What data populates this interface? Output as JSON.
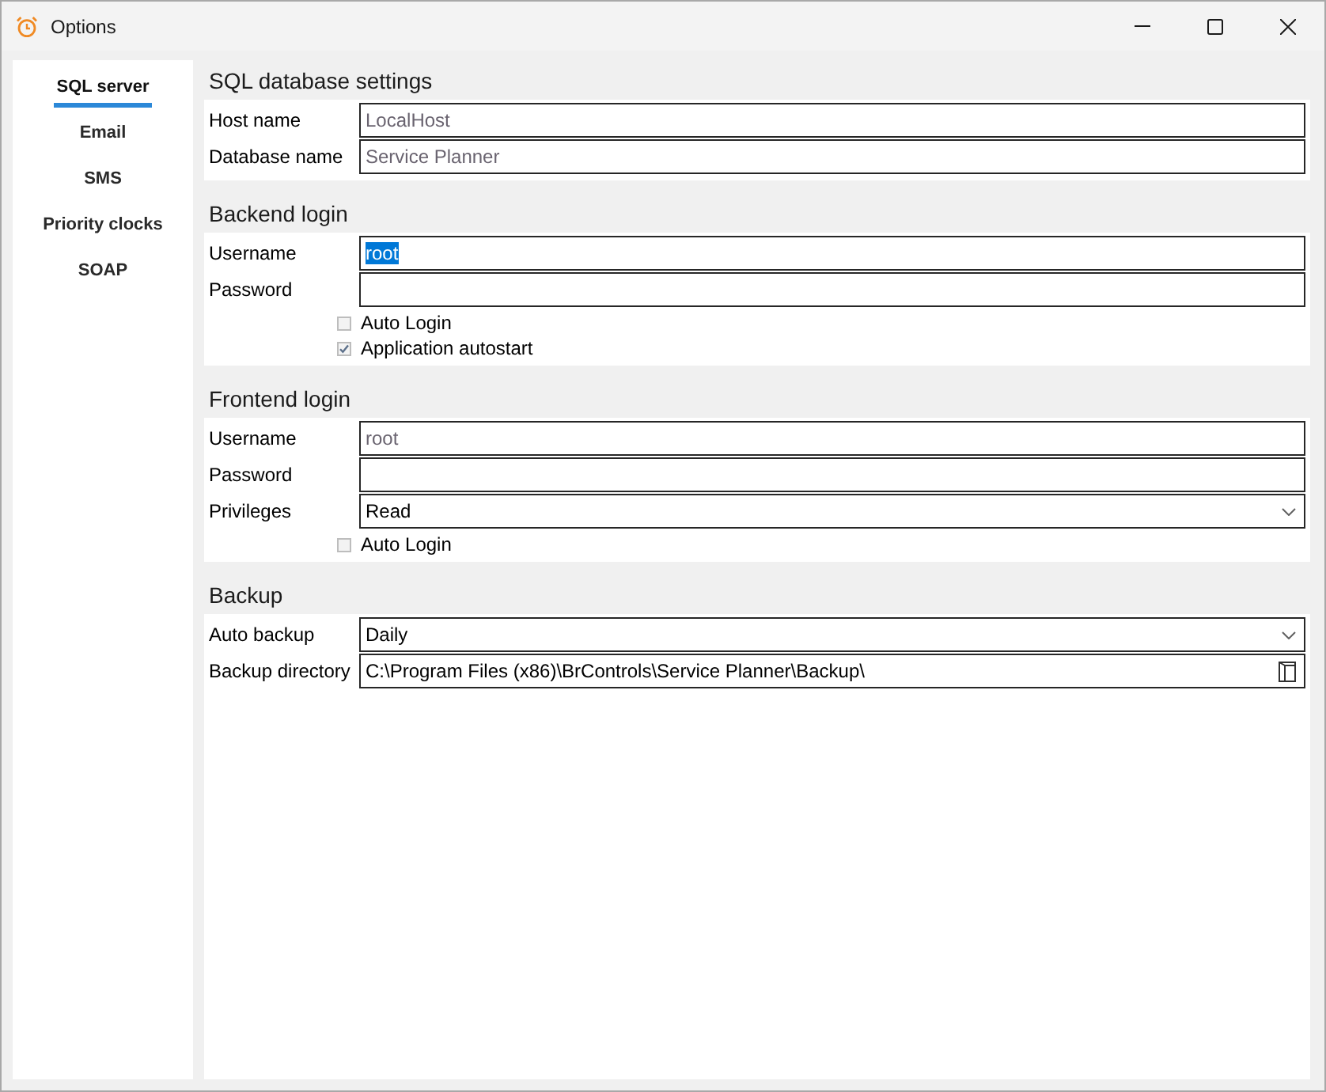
{
  "window": {
    "title": "Options"
  },
  "sidebar": {
    "items": [
      {
        "label": "SQL server",
        "selected": true
      },
      {
        "label": "Email",
        "selected": false
      },
      {
        "label": "SMS",
        "selected": false
      },
      {
        "label": "Priority clocks",
        "selected": false
      },
      {
        "label": "SOAP",
        "selected": false
      }
    ]
  },
  "sections": [
    {
      "title": "SQL database settings",
      "rows": [
        {
          "kind": "text",
          "label": "Host name",
          "placeholder": "LocalHost"
        },
        {
          "kind": "text",
          "label": "Database name",
          "placeholder": "Service Planner"
        }
      ]
    },
    {
      "title": "Backend login",
      "rows": [
        {
          "kind": "text",
          "label": "Username",
          "value": "root",
          "text_selected": true
        },
        {
          "kind": "text",
          "label": "Password"
        },
        {
          "kind": "checkbox",
          "label": "Auto Login",
          "checked": false
        },
        {
          "kind": "checkbox",
          "label": "Application autostart",
          "checked": true
        }
      ]
    },
    {
      "title": "Frontend login",
      "rows": [
        {
          "kind": "text",
          "label": "Username",
          "placeholder": "root"
        },
        {
          "kind": "text",
          "label": "Password"
        },
        {
          "kind": "dropdown",
          "label": "Privileges",
          "value": "Read"
        },
        {
          "kind": "checkbox",
          "label": "Auto Login",
          "checked": false
        }
      ]
    },
    {
      "title": "Backup",
      "rows": [
        {
          "kind": "dropdown",
          "label": "Auto backup",
          "value": "Daily"
        },
        {
          "kind": "folder",
          "label": "Backup directory",
          "value": "C:\\Program Files (x86)\\BrControls\\Service Planner\\Backup\\"
        }
      ]
    }
  ]
}
